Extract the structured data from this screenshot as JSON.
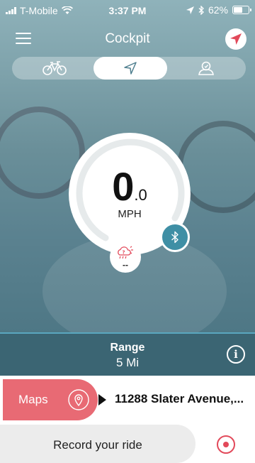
{
  "status_bar": {
    "carrier": "T-Mobile",
    "time": "3:37 PM",
    "battery": "62%",
    "battery_level": 0.62
  },
  "nav": {
    "title": "Cockpit"
  },
  "mode_toggle": {
    "segments": [
      "bike-icon",
      "navigation-arrow-icon",
      "rider-icon"
    ],
    "active_index": 1
  },
  "gauge": {
    "speed_int": "0",
    "speed_dec": ".0",
    "unit": "MPH",
    "progress": 0.0
  },
  "weather": {
    "icon": "cloud-sun-rain-unknown-icon",
    "value": "--"
  },
  "range": {
    "label": "Range",
    "value": "5 Mi"
  },
  "maps": {
    "label": "Maps",
    "address": "11288 Slater Avenue,..."
  },
  "record": {
    "label": "Record your ride"
  },
  "colors": {
    "accent": "#e86a74",
    "range_bar": "#3b6573",
    "bluetooth": "#3f8fa5",
    "record": "#e2495a"
  }
}
